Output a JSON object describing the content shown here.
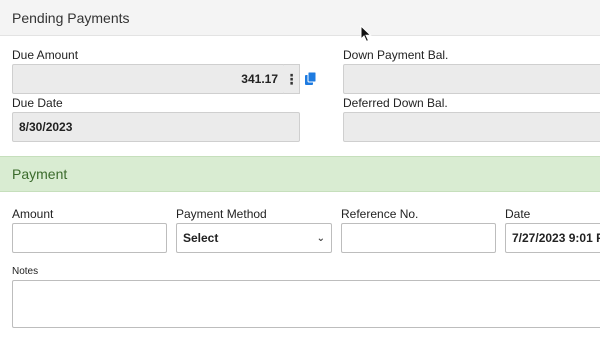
{
  "pending": {
    "title": "Pending Payments",
    "due_amount_label": "Due Amount",
    "due_amount_value": "341.17",
    "down_payment_label": "Down Payment Bal.",
    "down_payment_value": "",
    "due_date_label": "Due Date",
    "due_date_value": "8/30/2023",
    "deferred_label": "Deferred Down Bal.",
    "deferred_value": ""
  },
  "payment": {
    "title": "Payment",
    "amount_label": "Amount",
    "amount_value": "",
    "method_label": "Payment Method",
    "method_value": "Select",
    "reference_label": "Reference No.",
    "reference_value": "",
    "date_label": "Date",
    "date_value": "7/27/2023 9:01 F",
    "notes_label": "Notes",
    "notes_value": ""
  },
  "icons": {
    "menu": "kebab-menu-icon",
    "copy": "copy-icon",
    "chevron": "chevron-down-icon",
    "cursor": "mouse-cursor-icon"
  },
  "colors": {
    "payment_header_bg": "#d9ecd2",
    "payment_header_text": "#3b6b2c",
    "copy_icon": "#1e7be0",
    "readonly_bg": "#ebebeb"
  }
}
